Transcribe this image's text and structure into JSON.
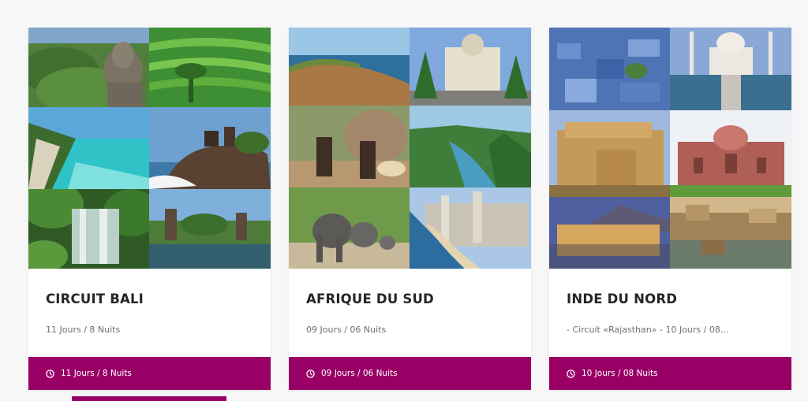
{
  "colors": {
    "accent": "#990066",
    "background": "#f7f7f7",
    "card": "#ffffff",
    "title": "#262626",
    "subtitle": "#6e6e6e"
  },
  "cards": [
    {
      "title": "CIRCUIT BALI",
      "subtitle": "11 Jours / 8 Nuits",
      "duration": "11 Jours / 8 Nuits",
      "icon": "clock-icon",
      "photos": [
        "buddha-statue-forest",
        "rice-terraces",
        "turquoise-beach-cliffs",
        "tanah-lot-temple",
        "jungle-waterfall",
        "water-temple-pond"
      ]
    },
    {
      "title": "AFRIQUE DU SUD",
      "subtitle": "09 Jours / 06 Nuits",
      "duration": "09 Jours / 06 Nuits",
      "icon": "clock-icon",
      "photos": [
        "coastal-cliffs",
        "city-hall-palms",
        "zulu-village",
        "green-canyon",
        "elephants-savanna",
        "durban-beachfront"
      ]
    },
    {
      "title": "INDE DU NORD",
      "subtitle": "- Circuit «Rajasthan» - 10 Jours / 08...",
      "duration": "10 Jours / 08 Nuits",
      "icon": "clock-icon",
      "photos": [
        "blue-city-jodhpur",
        "taj-mahal",
        "jaisalmer-fort",
        "red-fort-palace",
        "jal-mahal-lake",
        "udaipur-palace"
      ]
    }
  ]
}
